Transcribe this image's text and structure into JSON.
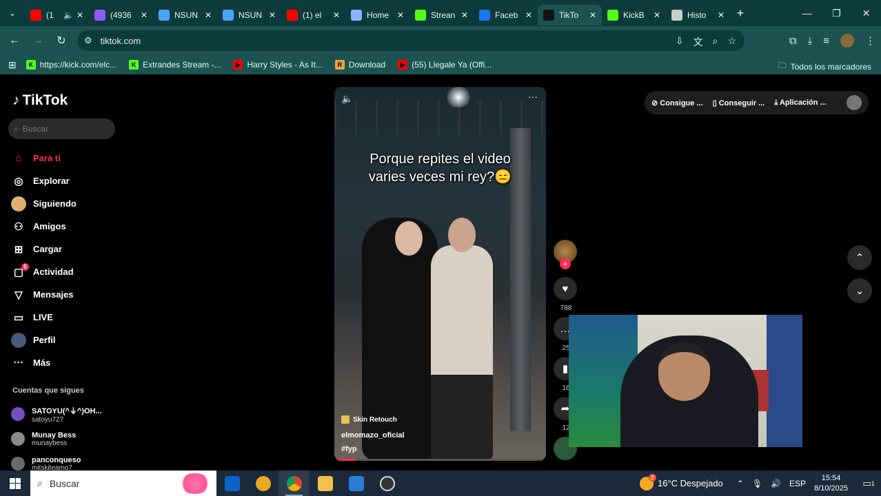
{
  "browser": {
    "tabs": [
      {
        "label": "(1",
        "color": "#ff0000",
        "icon": "youtube-icon",
        "audio": true
      },
      {
        "label": "(4936",
        "color": "#8b5cf6",
        "icon": "app-icon"
      },
      {
        "label": "NSUN",
        "color": "#4aa3ff",
        "icon": "wave-icon"
      },
      {
        "label": "NSUN",
        "color": "#4aa3ff",
        "icon": "wave-icon"
      },
      {
        "label": "(1) el",
        "color": "#ff0000",
        "icon": "youtube-icon"
      },
      {
        "label": "Home",
        "color": "#8ab4ff",
        "icon": "diamond-icon"
      },
      {
        "label": "Strean",
        "color": "#53fc18",
        "icon": "kick-icon"
      },
      {
        "label": "Faceb",
        "color": "#1877f2",
        "icon": "facebook-icon"
      },
      {
        "label": "TikTo",
        "color": "#111111",
        "icon": "tiktok-icon",
        "active": true
      },
      {
        "label": "KickB",
        "color": "#53fc18",
        "icon": "kick-icon"
      },
      {
        "label": "Histo",
        "color": "#cccccc",
        "icon": "download-icon"
      }
    ],
    "url": "tiktok.com",
    "bookmarks": [
      {
        "label": "https://kick.com/elc...",
        "color": "#53fc18",
        "glyph": "K"
      },
      {
        "label": "Extrandes Stream -...",
        "color": "#53fc18",
        "glyph": "K"
      },
      {
        "label": "Harry Styles - As It...",
        "color": "#ff0000",
        "glyph": "▶"
      },
      {
        "label": "Download",
        "color": "#e8a33c",
        "glyph": "R"
      },
      {
        "label": "(55) Llegale Ya (Offi...",
        "color": "#ff0000",
        "glyph": "▶"
      }
    ],
    "all_bookmarks": "Todos los marcadores"
  },
  "tiktok": {
    "logo": "TikTok",
    "search_placeholder": "Buscar",
    "nav": [
      {
        "label": "Para ti",
        "icon": "home-icon",
        "glyph": "⌂",
        "active": true
      },
      {
        "label": "Explorar",
        "icon": "compass-icon",
        "glyph": "◎"
      },
      {
        "label": "Siguiendo",
        "icon": "avatar-icon",
        "glyph": ""
      },
      {
        "label": "Amigos",
        "icon": "friends-icon",
        "glyph": "⚇"
      },
      {
        "label": "Cargar",
        "icon": "upload-icon",
        "glyph": "⊞"
      },
      {
        "label": "Actividad",
        "icon": "activity-icon",
        "glyph": "▢",
        "badge": "5"
      },
      {
        "label": "Mensajes",
        "icon": "messages-icon",
        "glyph": "▽"
      },
      {
        "label": "LIVE",
        "icon": "live-icon",
        "glyph": "▭"
      },
      {
        "label": "Perfil",
        "icon": "profile-icon",
        "glyph": ""
      },
      {
        "label": "Más",
        "icon": "more-icon",
        "glyph": "···"
      }
    ],
    "following_header": "Cuentas que sigues",
    "following": [
      {
        "name": "SATOYU(^⏚^)OH...",
        "user": "satoyu727",
        "color": "#7a4bc2"
      },
      {
        "name": "Munay Bess",
        "user": "munaybess",
        "color": "#8a8a8a"
      },
      {
        "name": "panconqueso",
        "user": "mitskiteamo7",
        "color": "#6a6a6a"
      }
    ],
    "video": {
      "caption": "Porque repites el video varies veces mi rey?😑",
      "brand": "Skin Retouch",
      "username": "elmomazo_oficial",
      "hashtag": "#fyp",
      "progress": 0.1
    },
    "actions": {
      "likes": "788",
      "comments": "25",
      "saves": "16",
      "shares": "12"
    },
    "top_links": [
      "Consigue ...",
      "Conseguir ...",
      "Aplicación ..."
    ]
  },
  "taskbar": {
    "search": "Buscar",
    "weather": "16°C  Despejado",
    "weather_badge": "2",
    "lang": "ESP",
    "time": "15:54",
    "date": "8/10/2025",
    "notifications": "1"
  }
}
